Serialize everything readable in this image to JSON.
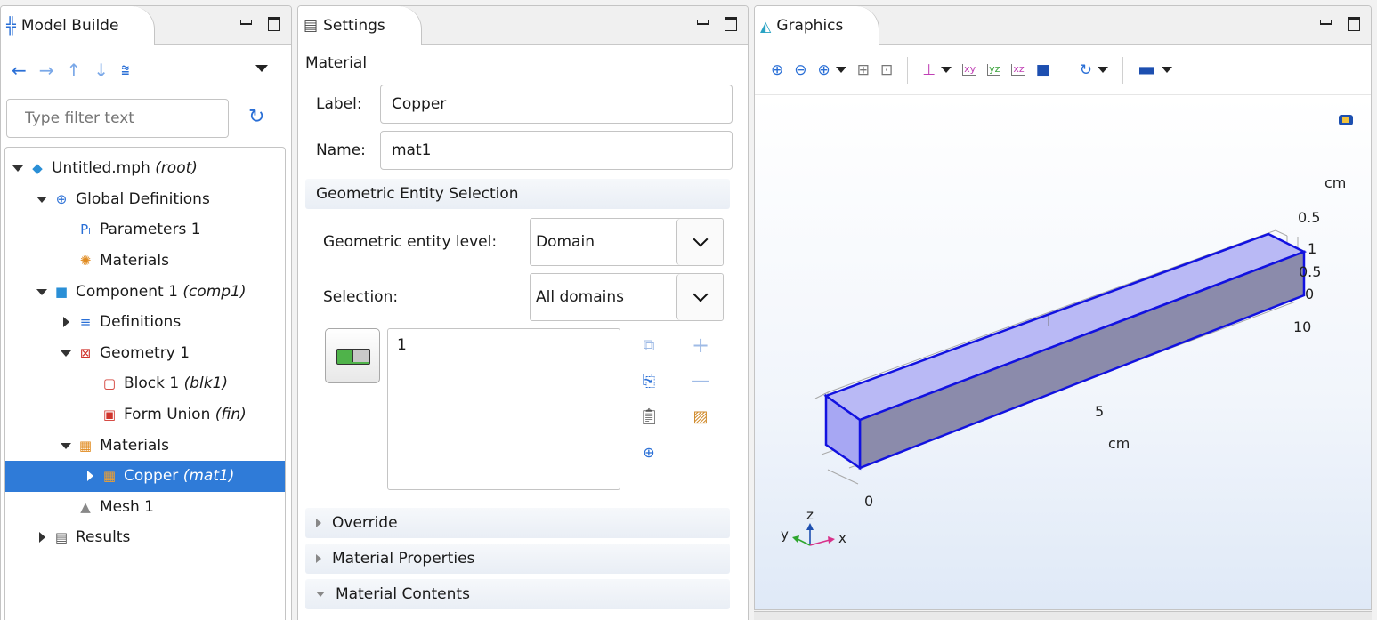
{
  "model_builder": {
    "tab_title": "Model Builde",
    "filter_placeholder": "Type filter text",
    "tree": [
      {
        "label": "Untitled.mph",
        "tag": "(root)",
        "icon": "mph-file-icon",
        "caret": "down",
        "indent": 0
      },
      {
        "label": "Global Definitions",
        "tag": "",
        "icon": "globe-icon",
        "caret": "down",
        "indent": 1
      },
      {
        "label": "Parameters 1",
        "tag": "",
        "icon": "parameters-icon",
        "caret": "none",
        "indent": 2
      },
      {
        "label": "Materials",
        "tag": "",
        "icon": "global-materials-icon",
        "caret": "none",
        "indent": 2
      },
      {
        "label": "Component 1",
        "tag": "(comp1)",
        "icon": "component-icon",
        "caret": "down",
        "indent": 1
      },
      {
        "label": "Definitions",
        "tag": "",
        "icon": "definitions-icon",
        "caret": "right",
        "indent": 2
      },
      {
        "label": "Geometry 1",
        "tag": "",
        "icon": "geometry-icon",
        "caret": "down",
        "indent": 2
      },
      {
        "label": "Block 1",
        "tag": "(blk1)",
        "icon": "block-icon",
        "caret": "none",
        "indent": 3
      },
      {
        "label": "Form Union",
        "tag": "(fin)",
        "icon": "form-union-icon",
        "caret": "none",
        "indent": 3
      },
      {
        "label": "Materials",
        "tag": "",
        "icon": "materials-icon",
        "caret": "down",
        "indent": 2
      },
      {
        "label": "Copper",
        "tag": "(mat1)",
        "icon": "material-icon",
        "caret": "right",
        "indent": 3,
        "selected": true
      },
      {
        "label": "Mesh 1",
        "tag": "",
        "icon": "mesh-icon",
        "caret": "none",
        "indent": 2
      },
      {
        "label": "Results",
        "tag": "",
        "icon": "results-icon",
        "caret": "right",
        "indent": 1
      }
    ]
  },
  "settings": {
    "tab_title": "Settings",
    "node_type": "Material",
    "label_label": "Label:",
    "label_value": "Copper",
    "name_label": "Name:",
    "name_value": "mat1",
    "section_geometric": "Geometric Entity Selection",
    "entity_level_label": "Geometric entity level:",
    "entity_level_value": "Domain",
    "selection_label": "Selection:",
    "selection_value": "All domains",
    "selection_list": [
      "1"
    ],
    "section_override": "Override",
    "section_properties": "Material Properties",
    "section_contents": "Material Contents"
  },
  "graphics": {
    "tab_title": "Graphics",
    "axis_unit_top": "cm",
    "axis_unit_bottom": "cm",
    "ticks_x": [
      "0",
      "5",
      "10"
    ],
    "ticks_y": [
      "0.5"
    ],
    "ticks_z": [
      "1",
      "0.5",
      "0"
    ],
    "triad": {
      "z": "z",
      "y": "y",
      "x": "x"
    },
    "colors": {
      "block_face": "#a9a9f2",
      "block_edge": "#1212e0",
      "selection": "#2f7bd8"
    }
  }
}
